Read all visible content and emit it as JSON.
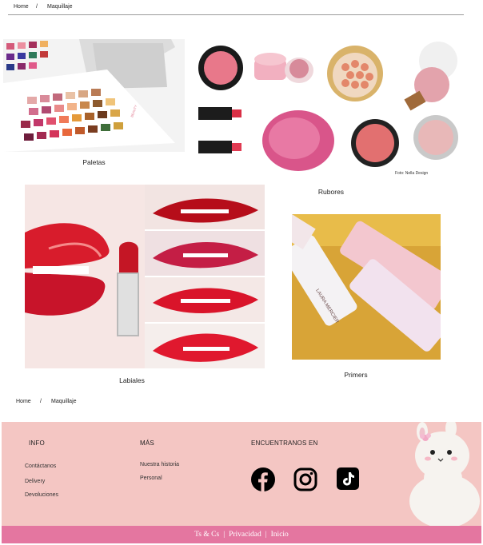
{
  "breadcrumb_top": {
    "home": "Home",
    "separator": "/",
    "current": "Maquillaje"
  },
  "products": [
    {
      "id": "paletas",
      "label": "Paletas"
    },
    {
      "id": "rubores",
      "label": "Rubores",
      "credit": "Foto: Nella Design"
    },
    {
      "id": "labiales",
      "label": "Labiales"
    },
    {
      "id": "primers",
      "label": "Primers",
      "brand": "LAURA MERCIER"
    }
  ],
  "breadcrumb_bottom": {
    "home": "Home",
    "separator": "/",
    "current": "Maquillaje"
  },
  "footer": {
    "info": {
      "heading": "INFO",
      "links": [
        "Contáctanos",
        "Delivery",
        "Devoluciones"
      ]
    },
    "mas": {
      "heading": "MÁS",
      "links": [
        "Nuestra historia",
        "Personal"
      ]
    },
    "social": {
      "heading": "ENCUENTRANOS EN",
      "icons": [
        "facebook-icon",
        "instagram-icon",
        "tiktok-icon"
      ]
    },
    "bottom_links": [
      "Ts & Cs",
      "Privacidad",
      "Inicio"
    ],
    "bottom_separator": "|"
  },
  "colors": {
    "footer_bg": "#f4c6c3",
    "bottom_bar": "#e476a0",
    "lips_red": "#d81c2c",
    "blush_pink": "#e07b92"
  }
}
